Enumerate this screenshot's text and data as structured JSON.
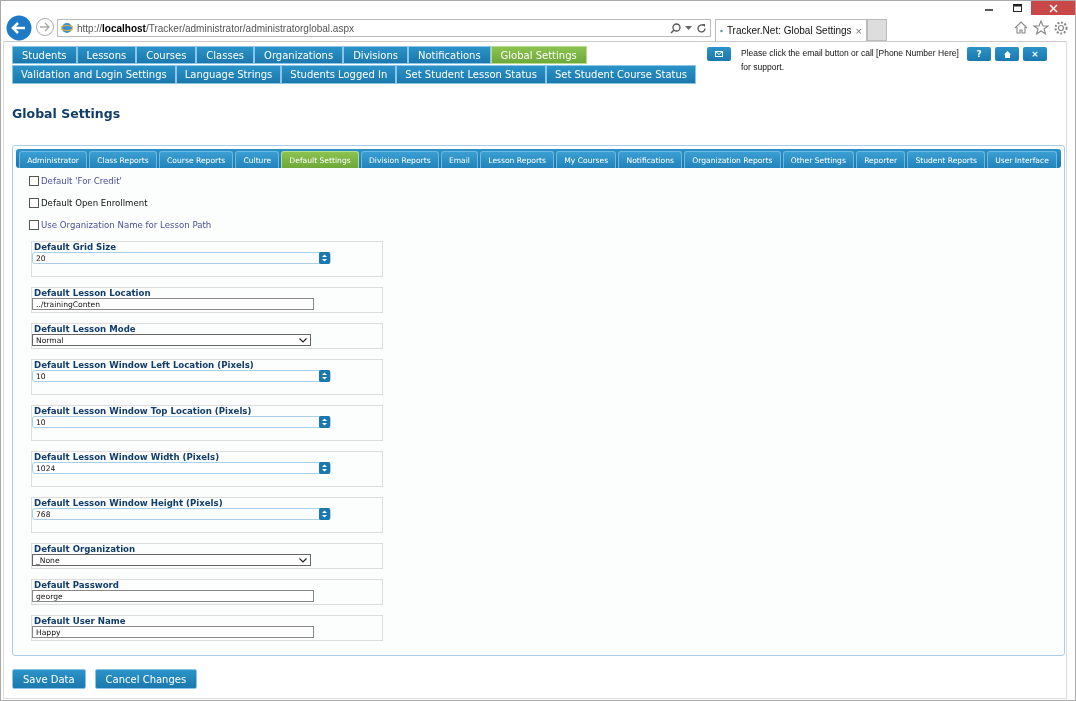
{
  "browser": {
    "url": "http://**localhost**/Tracker/administrator/administratorglobal.aspx",
    "tab": {
      "title": "Tracker.Net: Global Settings",
      "close": "×"
    }
  },
  "main_nav": [
    [
      {
        "label": "Students",
        "selected": false
      },
      {
        "label": "Lessons",
        "selected": false
      },
      {
        "label": "Courses",
        "selected": false
      },
      {
        "label": "Classes",
        "selected": false
      },
      {
        "label": "Organizations",
        "selected": false
      },
      {
        "label": "Divisions",
        "selected": false
      },
      {
        "label": "Notifications",
        "selected": false
      },
      {
        "label": "Global Settings",
        "selected": true
      }
    ],
    [
      {
        "label": "Validation and Login Settings",
        "selected": false
      },
      {
        "label": "Language Strings",
        "selected": false
      },
      {
        "label": "Students Logged In",
        "selected": false
      },
      {
        "label": "Set Student Lesson Status",
        "selected": false
      },
      {
        "label": "Set Student Course Status",
        "selected": false
      }
    ]
  ],
  "support": {
    "message": "Please click the email button or call [Phone Number Here] for support.",
    "help_button": "?",
    "close_button": "×"
  },
  "page_title": "Global Settings",
  "settings_tabs": [
    {
      "label": "Administrator",
      "selected": false
    },
    {
      "label": "Class Reports",
      "selected": false
    },
    {
      "label": "Course Reports",
      "selected": false
    },
    {
      "label": "Culture",
      "selected": false
    },
    {
      "label": "Default Settings",
      "selected": true
    },
    {
      "label": "Division Reports",
      "selected": false
    },
    {
      "label": "Email",
      "selected": false
    },
    {
      "label": "Lesson Reports",
      "selected": false
    },
    {
      "label": "My Courses",
      "selected": false
    },
    {
      "label": "Notifications",
      "selected": false
    },
    {
      "label": "Organization Reports",
      "selected": false
    },
    {
      "label": "Other Settings",
      "selected": false
    },
    {
      "label": "Reporter",
      "selected": false
    },
    {
      "label": "Student Reports",
      "selected": false
    },
    {
      "label": "User Interface",
      "selected": false
    }
  ],
  "checkboxes": [
    {
      "label": "Default 'For Credit'",
      "checked": false,
      "kind": "link"
    },
    {
      "label": "Default Open Enrollment",
      "checked": false,
      "kind": "plain"
    },
    {
      "label": "Use Organization Name for Lesson Path",
      "checked": false,
      "kind": "link"
    }
  ],
  "fields": [
    {
      "label": "Default Grid Size",
      "kind": "spinner",
      "value": "20"
    },
    {
      "label": "Default Lesson Location",
      "kind": "text",
      "value": "../trainingConten"
    },
    {
      "label": "Default Lesson Mode",
      "kind": "select",
      "value": "Normal"
    },
    {
      "label": "Default Lesson Window Left Location (Pixels)",
      "kind": "spinner",
      "value": "10"
    },
    {
      "label": "Default Lesson Window Top Location (Pixels)",
      "kind": "spinner",
      "value": "10"
    },
    {
      "label": "Default Lesson Window Width (Pixels)",
      "kind": "spinner",
      "value": "1024"
    },
    {
      "label": "Default Lesson Window Height (Pixels)",
      "kind": "spinner",
      "value": "768"
    },
    {
      "label": "Default Organization",
      "kind": "select",
      "value": "_None"
    },
    {
      "label": "Default Password",
      "kind": "text",
      "value": "george"
    },
    {
      "label": "Default User Name",
      "kind": "text",
      "value": "Happy"
    }
  ],
  "buttons": [
    "Save Data",
    "Cancel Changes"
  ]
}
